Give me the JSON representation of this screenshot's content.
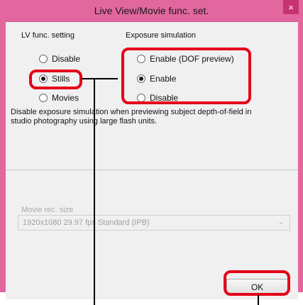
{
  "window": {
    "title": "Live View/Movie func. set.",
    "close_glyph": "×"
  },
  "lv_func": {
    "label": "LV func. setting",
    "options": [
      "Disable",
      "Stills",
      "Movies"
    ],
    "selected": "Stills"
  },
  "exposure": {
    "label": "Exposure simulation",
    "options": [
      "Enable (DOF preview)",
      "Enable",
      "Disable"
    ],
    "selected": "Enable"
  },
  "description": "Disable exposure simulation when previewing subject depth-of-field in studio photography using large flash units.",
  "movie": {
    "label": "Movie rec. size",
    "value": "1920x1080  29.97 fps Standard (IPB)"
  },
  "ok_label": "OK",
  "colors": {
    "titlebar": "#e2679e",
    "close_button": "#c7336f",
    "highlight": "#e5001a"
  },
  "icons": [
    "close-icon",
    "radio-icon",
    "chevron-down-icon"
  ]
}
